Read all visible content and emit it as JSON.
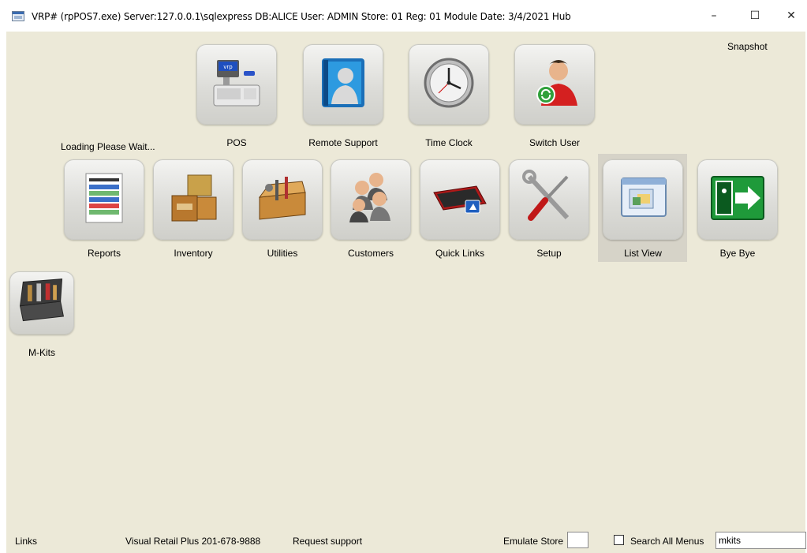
{
  "window": {
    "title": "VRP# (rpPOS7.exe) Server:127.0.0.1\\sqlexpress  DB:ALICE  User: ADMIN Store: 01 Reg: 01  Module Date: 3/4/2021  Hub",
    "minimize": "–",
    "maximize": "☐",
    "close": "✕"
  },
  "snapshot": "Snapshot",
  "loading": "Loading Please Wait...",
  "tiles_row1": [
    {
      "label": "POS",
      "icon": "cash-register-icon"
    },
    {
      "label": "Remote Support",
      "icon": "remote-support-icon"
    },
    {
      "label": "Time Clock",
      "icon": "clock-icon"
    },
    {
      "label": "Switch User",
      "icon": "switch-user-icon"
    }
  ],
  "tiles_row2": [
    {
      "label": "Reports",
      "icon": "report-icon"
    },
    {
      "label": "Inventory",
      "icon": "boxes-icon"
    },
    {
      "label": "Utilities",
      "icon": "toolbox-icon"
    },
    {
      "label": "Customers",
      "icon": "customers-icon"
    },
    {
      "label": "Quick Links",
      "icon": "keyboard-icon"
    },
    {
      "label": "Setup",
      "icon": "tools-icon"
    },
    {
      "label": "List View",
      "icon": "list-view-icon"
    },
    {
      "label": "Bye Bye",
      "icon": "exit-icon"
    }
  ],
  "tiles_row3": [
    {
      "label": "M-Kits",
      "icon": "tool-kit-icon"
    }
  ],
  "footer": {
    "links": "Links",
    "phone": "Visual Retail Plus 201-678-9888",
    "request_support": "Request support",
    "emulate_store": "Emulate Store",
    "emulate_store_value": "",
    "search_all_menus": "Search All Menus",
    "search_all_menus_checked": false,
    "search_value": "mkits"
  },
  "colors": {
    "background": "#ece9d8",
    "selected": "#d6d3c8"
  }
}
